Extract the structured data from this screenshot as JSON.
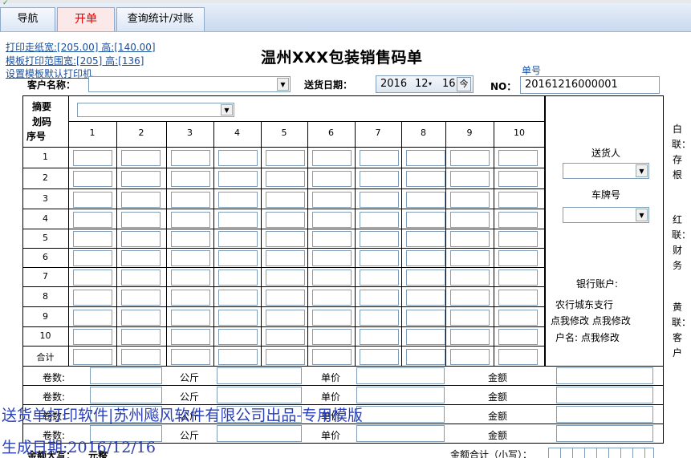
{
  "tabs": [
    {
      "label": "导航",
      "active": false
    },
    {
      "label": "开单",
      "active": true
    },
    {
      "label": "查询统计/对账",
      "active": false
    }
  ],
  "links": {
    "paper_size": "打印走纸宽:[205.00] 高:[140.00]",
    "template_range": "模板打印范围宽:[205] 高:[136]",
    "set_default": "设置模板默认打印机"
  },
  "form": {
    "title": "温州XXX包装销售码单",
    "customer_label": "客户名称：",
    "customer_value": "",
    "delivery_date_label": "送货日期：",
    "date": {
      "year": "2016",
      "month": "12",
      "day": "16",
      "today_button": "今"
    },
    "order_no_caption": "单号",
    "order_no_label": "NO：",
    "order_no_value": "20161216000001"
  },
  "grid": {
    "summary_label": "摘要",
    "code_label": "划码",
    "seq_label": "序号",
    "columns": [
      "1",
      "2",
      "3",
      "4",
      "5",
      "6",
      "7",
      "8",
      "9",
      "10"
    ],
    "rows": [
      "1",
      "2",
      "3",
      "4",
      "5",
      "6",
      "7",
      "8",
      "9",
      "10",
      "合计"
    ]
  },
  "side": {
    "deliverer_label": "送货人",
    "plate_label": "车牌号",
    "bank_label": "银行账户:",
    "bank_line1": "农行城东支行",
    "bank_line2": "点我修改 点我修改",
    "bank_line3": "户名: 点我修改"
  },
  "copies": {
    "white": "白联：存根",
    "red": "红联：财务",
    "yellow": "黄联：客户"
  },
  "bottom_rows": [
    {
      "rolls": "卷数:",
      "unit": "公斤",
      "price": "单价",
      "amount": "金额"
    },
    {
      "rolls": "卷数:",
      "unit": "公斤",
      "price": "单价",
      "amount": "金额"
    },
    {
      "rolls": "卷数:",
      "unit": "公斤",
      "price": "单价",
      "amount": "金额"
    },
    {
      "rolls": "卷数:",
      "unit": "公斤",
      "price": "单价",
      "amount": "金额"
    }
  ],
  "totals": {
    "capital_label": "金额大写：",
    "capital_value": "元整",
    "small_label": "金额合计（小写）："
  },
  "overlay": {
    "line1": "送货单打印软件|苏州飚风软件有限公司出品-专用模版",
    "line2": "生成日期:2016/12/16"
  }
}
